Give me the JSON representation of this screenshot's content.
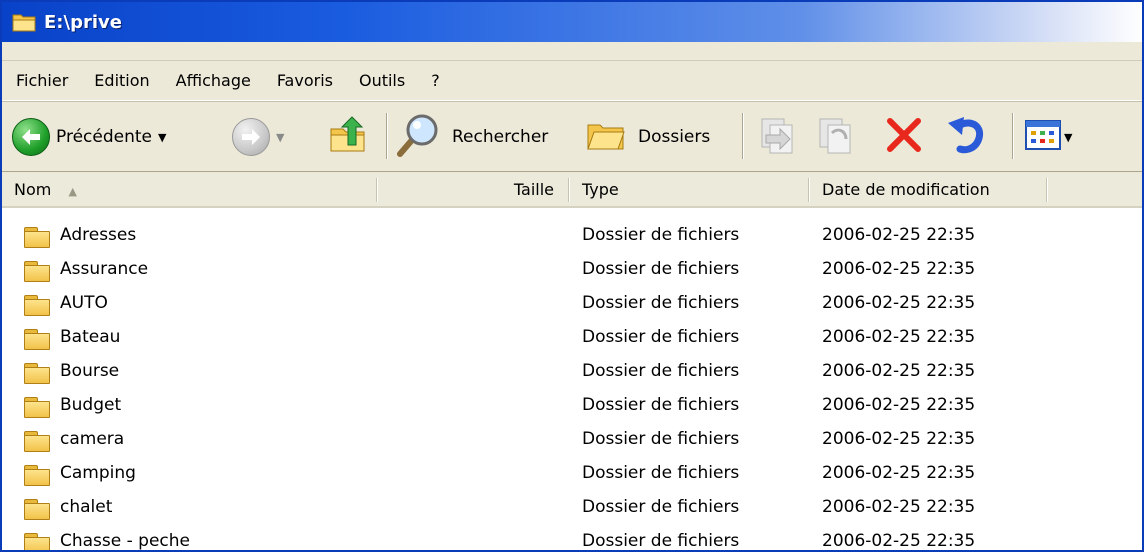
{
  "window": {
    "title": "E:\\prive"
  },
  "menu": [
    "Fichier",
    "Edition",
    "Affichage",
    "Favoris",
    "Outils",
    "?"
  ],
  "toolbar": {
    "back_label": "Précédente",
    "search_label": "Rechercher",
    "folders_label": "Dossiers"
  },
  "columns": {
    "name": "Nom",
    "size": "Taille",
    "type": "Type",
    "modified": "Date de modification"
  },
  "rows": [
    {
      "name": "Adresses",
      "size": "",
      "type": "Dossier de fichiers",
      "modified": "2006-02-25 22:35"
    },
    {
      "name": "Assurance",
      "size": "",
      "type": "Dossier de fichiers",
      "modified": "2006-02-25 22:35"
    },
    {
      "name": "AUTO",
      "size": "",
      "type": "Dossier de fichiers",
      "modified": "2006-02-25 22:35"
    },
    {
      "name": "Bateau",
      "size": "",
      "type": "Dossier de fichiers",
      "modified": "2006-02-25 22:35"
    },
    {
      "name": "Bourse",
      "size": "",
      "type": "Dossier de fichiers",
      "modified": "2006-02-25 22:35"
    },
    {
      "name": "Budget",
      "size": "",
      "type": "Dossier de fichiers",
      "modified": "2006-02-25 22:35"
    },
    {
      "name": "camera",
      "size": "",
      "type": "Dossier de fichiers",
      "modified": "2006-02-25 22:35"
    },
    {
      "name": "Camping",
      "size": "",
      "type": "Dossier de fichiers",
      "modified": "2006-02-25 22:35"
    },
    {
      "name": "chalet",
      "size": "",
      "type": "Dossier de fichiers",
      "modified": "2006-02-25 22:35"
    },
    {
      "name": "Chasse - peche",
      "size": "",
      "type": "Dossier de fichiers",
      "modified": "2006-02-25 22:35"
    }
  ],
  "icons": {
    "title": "folder-icon",
    "back": "back-arrow-icon",
    "forward": "forward-arrow-icon",
    "up": "folder-up-icon",
    "search": "magnifier-icon",
    "folders": "folders-icon",
    "move_to": "move-to-icon",
    "copy_to": "copy-to-icon",
    "delete": "delete-icon",
    "undo": "undo-icon",
    "views": "views-icon",
    "sort": "sort-ascending-icon"
  },
  "colors": {
    "titlebar": "#0842c8",
    "chrome": "#ece9d8",
    "delete": "#e8281c",
    "undo": "#2a5ad8"
  }
}
